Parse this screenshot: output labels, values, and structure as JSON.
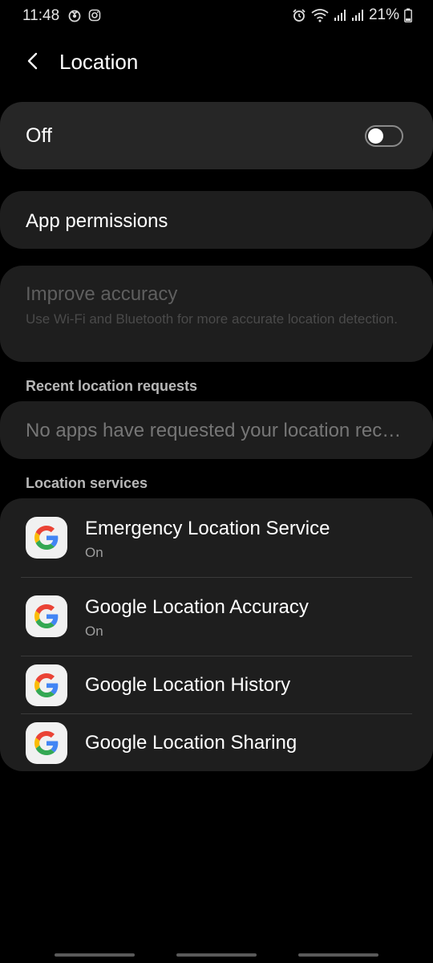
{
  "status_bar": {
    "time": "11:48",
    "battery": "21%",
    "left_icons": [
      "notification-app-icon",
      "instagram-icon"
    ],
    "right_icons": [
      "alarm-icon",
      "wifi-icon",
      "signal-icon",
      "signal-icon",
      "battery-icon"
    ]
  },
  "header": {
    "title": "Location"
  },
  "master_switch": {
    "label": "Off",
    "checked": false
  },
  "app_permissions": {
    "label": "App permissions"
  },
  "improve_accuracy": {
    "title": "Improve accuracy",
    "subtitle": "Use Wi-Fi and Bluetooth for more accurate location detection."
  },
  "recent_requests": {
    "header": "Recent location requests",
    "empty_text": "No apps have requested your location recently"
  },
  "location_services": {
    "header": "Location services",
    "items": [
      {
        "title": "Emergency Location Service",
        "subtitle": "On",
        "icon": "google-g-icon"
      },
      {
        "title": "Google Location Accuracy",
        "subtitle": "On",
        "icon": "google-g-icon"
      },
      {
        "title": "Google Location History",
        "icon": "google-g-icon"
      },
      {
        "title": "Google Location Sharing",
        "icon": "google-g-icon"
      }
    ]
  },
  "colors": {
    "background": "#000000",
    "card": "#1e1e1e",
    "master_card": "#262626",
    "disabled_text": "#5f5f5f",
    "google_blue": "#4285F4",
    "google_red": "#EA4335",
    "google_yellow": "#FBBC05",
    "google_green": "#34A853"
  }
}
